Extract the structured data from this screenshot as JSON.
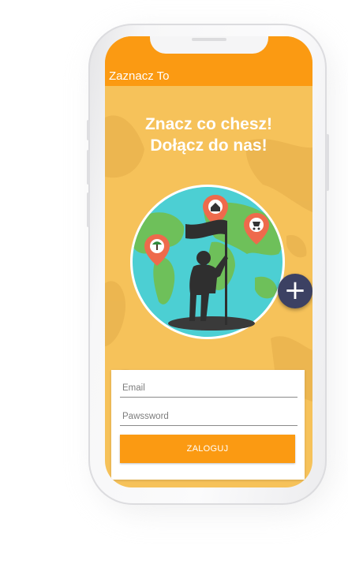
{
  "app": {
    "title": "Zaznacz To"
  },
  "hero": {
    "line1": "Znacz co chesz!",
    "line2": "Dołącz do nas!"
  },
  "fab": {
    "label": "+",
    "icon": "plus-icon"
  },
  "login_form": {
    "email_placeholder": "Email",
    "password_placeholder": "Pawssword",
    "submit_label": "ZALOGUJ"
  },
  "colors": {
    "accent": "#fb9a12",
    "background": "#f6c25a",
    "fab": "#3c4163",
    "ocean": "#4ccfd3",
    "land": "#6ec05a",
    "pin": "#ee6a4c"
  }
}
